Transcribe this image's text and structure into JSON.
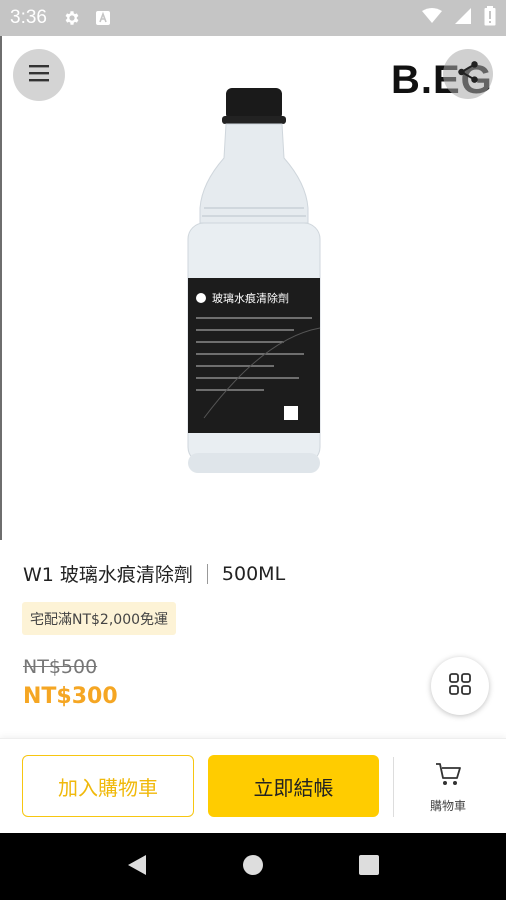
{
  "status_bar": {
    "time": "3:36",
    "icons": [
      "gear-icon",
      "a-icon",
      "wifi-icon",
      "signal-icon",
      "battery-icon"
    ]
  },
  "header": {
    "brand": "B.EG",
    "menu_icon": "hamburger-icon",
    "share_icon": "share-icon"
  },
  "product": {
    "image_alt": "product bottle",
    "bottle_label_title": "玻璃水痕清除劑",
    "name": "W1 玻璃水痕清除劑",
    "volume": "500ML",
    "shipping_tag": "宅配滿NT$2,000免運",
    "price_original": "NT$500",
    "price_sale": "NT$300"
  },
  "actions": {
    "add_to_cart": "加入購物車",
    "checkout": "立即結帳",
    "cart_label": "購物車"
  },
  "colors": {
    "accent": "#ffcc00",
    "price": "#f5a623",
    "tag_bg": "#fdf3d6"
  }
}
